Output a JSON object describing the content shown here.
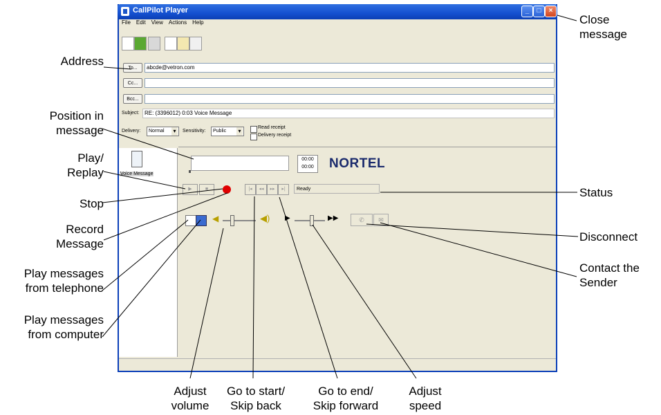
{
  "window": {
    "title": "CallPilot Player",
    "menu": [
      "File",
      "Edit",
      "View",
      "Actions",
      "Help"
    ]
  },
  "header": {
    "to_label": "To...",
    "to_value": "abcde@vetron.com",
    "cc_label": "Cc...",
    "cc_value": "",
    "bcc_label": "Bcc...",
    "bcc_value": "",
    "subject_label": "Subject:",
    "subject_value": "RE: (3396012) 0:03 Voice Message",
    "delivery_label": "Delivery:",
    "delivery_value": "Normal",
    "sensitivity_label": "Sensitivity:",
    "sensitivity_value": "Public",
    "read_receipt": "Read receipt",
    "delivery_receipt": "Delivery receipt"
  },
  "player": {
    "attachment_label": "Voice Message",
    "time_elapsed": "00:00",
    "time_total": "00:00",
    "logo": "NORTEL",
    "status": "Ready"
  },
  "callouts": {
    "close": "Close\nmessage",
    "address": "Address",
    "position": "Position in\nmessage",
    "play": "Play/\nReplay",
    "stop": "Stop",
    "record": "Record\nMessage",
    "phone": "Play messages\nfrom telephone",
    "computer": "Play messages\nfrom computer",
    "status": "Status",
    "disconnect": "Disconnect",
    "contact": "Contact the\nSender",
    "volume": "Adjust\nvolume",
    "start": "Go to start/\nSkip back",
    "end": "Go to end/\nSkip forward",
    "speed": "Adjust\nspeed"
  },
  "colors": {
    "titlebar": "#1450d0",
    "window_bg": "#ece9d8",
    "record_red": "#e00000",
    "logo_navy": "#1a2a6c"
  }
}
